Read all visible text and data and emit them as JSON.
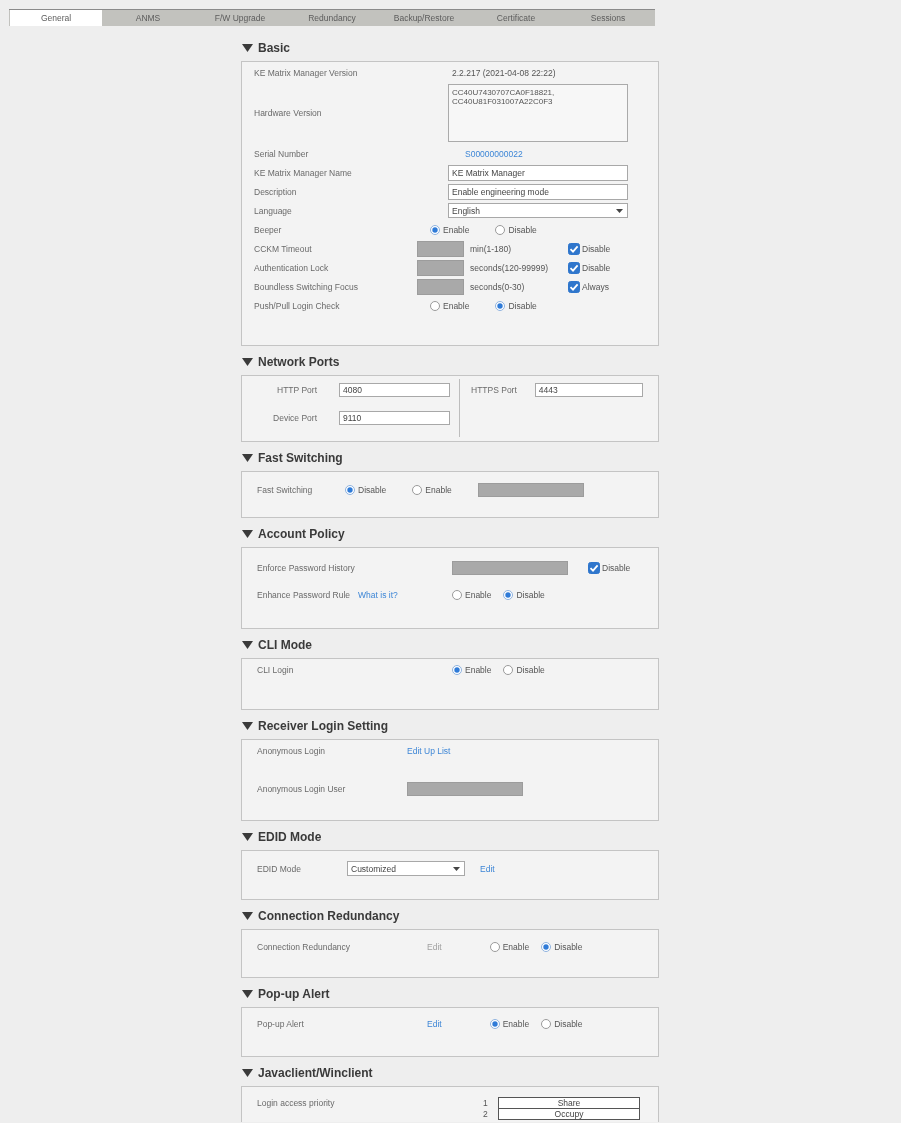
{
  "tabs": [
    {
      "label": "General",
      "selected": true
    },
    {
      "label": "ANMS",
      "selected": false
    },
    {
      "label": "F/W Upgrade",
      "selected": false
    },
    {
      "label": "Redundancy",
      "selected": false
    },
    {
      "label": "Backup/Restore",
      "selected": false
    },
    {
      "label": "Certificate",
      "selected": false
    },
    {
      "label": "Sessions",
      "selected": false
    }
  ],
  "sections": [
    {
      "title": "Basic",
      "expanded": true,
      "kind": "form",
      "rows": [
        {
          "label": "KE Matrix Manager Version",
          "controls": [
            {
              "kind": "text",
              "text": "2.2.217 (2021-04-08 22:22)"
            }
          ]
        },
        {
          "label": "Hardware Version",
          "controls": [
            {
              "kind": "textarea",
              "lines": [
                "CC40U7430707CA0F18821,",
                "CC40U81F031007A22C0F3"
              ]
            }
          ]
        },
        {
          "label": "Serial Number",
          "controls": [
            {
              "kind": "link",
              "text": "S00000000022",
              "disabled": false
            }
          ]
        },
        {
          "label": "KE Matrix Manager Name",
          "controls": [
            {
              "kind": "input",
              "value": "KE Matrix Manager",
              "disabled": false
            }
          ]
        },
        {
          "label": "Description",
          "controls": [
            {
              "kind": "input",
              "value": "Enable engineering mode",
              "disabled": false
            }
          ]
        },
        {
          "label": "Language",
          "controls": [
            {
              "kind": "select",
              "value": "English"
            }
          ]
        },
        {
          "label": "Beeper",
          "controls": [
            {
              "kind": "radio",
              "label": "Enable",
              "selected": true
            },
            {
              "kind": "radio",
              "label": "Disable",
              "selected": false
            }
          ]
        },
        {
          "label": "CCKM Timeout",
          "controls": [
            {
              "kind": "input",
              "disabled": true
            },
            {
              "kind": "text",
              "text": "min(1-180)"
            },
            {
              "kind": "checkbox",
              "label": "Disable",
              "checked": true
            }
          ]
        },
        {
          "label": "Authentication Lock",
          "controls": [
            {
              "kind": "input",
              "disabled": true
            },
            {
              "kind": "text",
              "text": "seconds(120-99999)"
            },
            {
              "kind": "checkbox",
              "label": "Disable",
              "checked": true
            }
          ]
        },
        {
          "label": "Boundless Switching Focus",
          "controls": [
            {
              "kind": "input",
              "disabled": true
            },
            {
              "kind": "text",
              "text": "seconds(0-30)"
            },
            {
              "kind": "checkbox",
              "label": "Always",
              "checked": true
            }
          ]
        },
        {
          "label": "Push/Pull Login Check",
          "controls": [
            {
              "kind": "radio",
              "label": "Enable",
              "selected": false
            },
            {
              "kind": "radio",
              "label": "Disable",
              "selected": true
            }
          ]
        }
      ]
    },
    {
      "title": "Network Ports",
      "expanded": true,
      "kind": "columns",
      "columns": [
        {
          "rows": [
            {
              "label": "HTTP Port",
              "controls": [
                {
                  "kind": "input",
                  "value": "4080",
                  "disabled": false
                }
              ]
            },
            {
              "label": "Device Port",
              "controls": [
                {
                  "kind": "input",
                  "value": "9110",
                  "disabled": false
                }
              ]
            }
          ]
        },
        {
          "rows": [
            {
              "label": "HTTPS Port",
              "controls": [
                {
                  "kind": "input",
                  "value": "4443",
                  "disabled": false
                }
              ]
            }
          ]
        }
      ]
    },
    {
      "title": "Fast Switching",
      "expanded": true,
      "kind": "form",
      "rows": [
        {
          "label": "Fast Switching",
          "controls": [
            {
              "kind": "radio",
              "label": "Disable",
              "selected": true
            },
            {
              "kind": "radio",
              "label": "Enable",
              "selected": false
            },
            {
              "kind": "input",
              "disabled": true
            }
          ]
        }
      ]
    },
    {
      "title": "Account Policy",
      "expanded": true,
      "kind": "form",
      "rows": [
        {
          "label": "Enforce Password History",
          "controls": [
            {
              "kind": "input",
              "disabled": true
            },
            {
              "kind": "checkbox",
              "label": "Disable",
              "checked": true
            }
          ]
        },
        {
          "label": "Enhance Password Rule",
          "help_link": "What is it?",
          "controls": [
            {
              "kind": "radio",
              "label": "Enable",
              "selected": false
            },
            {
              "kind": "radio",
              "label": "Disable",
              "selected": true
            }
          ]
        }
      ]
    },
    {
      "title": "CLI Mode",
      "expanded": true,
      "kind": "form",
      "rows": [
        {
          "label": "CLI Login",
          "controls": [
            {
              "kind": "radio",
              "label": "Enable",
              "selected": true
            },
            {
              "kind": "radio",
              "label": "Disable",
              "selected": false
            }
          ]
        }
      ]
    },
    {
      "title": "Receiver Login Setting",
      "expanded": true,
      "kind": "form",
      "rows": [
        {
          "label": "Anonymous Login",
          "controls": [
            {
              "kind": "link",
              "text": "Edit Up List",
              "disabled": false
            }
          ]
        },
        {
          "label": "Anonymous Login User",
          "controls": [
            {
              "kind": "input",
              "disabled": true
            }
          ]
        }
      ]
    },
    {
      "title": "EDID Mode",
      "expanded": true,
      "kind": "form",
      "rows": [
        {
          "label": "EDID Mode",
          "controls": [
            {
              "kind": "select",
              "value": "Customized"
            },
            {
              "kind": "link",
              "text": "Edit",
              "disabled": false
            }
          ]
        }
      ]
    },
    {
      "title": "Connection Redundancy",
      "expanded": true,
      "kind": "form",
      "rows": [
        {
          "label": "Connection Redundancy",
          "controls": [
            {
              "kind": "link",
              "text": "Edit",
              "disabled": true
            },
            {
              "kind": "radio",
              "label": "Enable",
              "selected": false
            },
            {
              "kind": "radio",
              "label": "Disable",
              "selected": true
            }
          ]
        }
      ]
    },
    {
      "title": "Pop-up Alert",
      "expanded": true,
      "kind": "form",
      "rows": [
        {
          "label": "Pop-up Alert",
          "controls": [
            {
              "kind": "link",
              "text": "Edit",
              "disabled": false
            },
            {
              "kind": "radio",
              "label": "Enable",
              "selected": true
            },
            {
              "kind": "radio",
              "label": "Disable",
              "selected": false
            }
          ]
        }
      ]
    },
    {
      "title": "Javaclient/Winclient",
      "expanded": true,
      "kind": "form",
      "rows": [
        {
          "label": "Login access priority",
          "controls": [
            {
              "kind": "priority_list",
              "items": [
                {
                  "number": "1",
                  "label": "Share"
                },
                {
                  "number": "2",
                  "label": "Occupy"
                }
              ]
            }
          ]
        }
      ]
    }
  ]
}
